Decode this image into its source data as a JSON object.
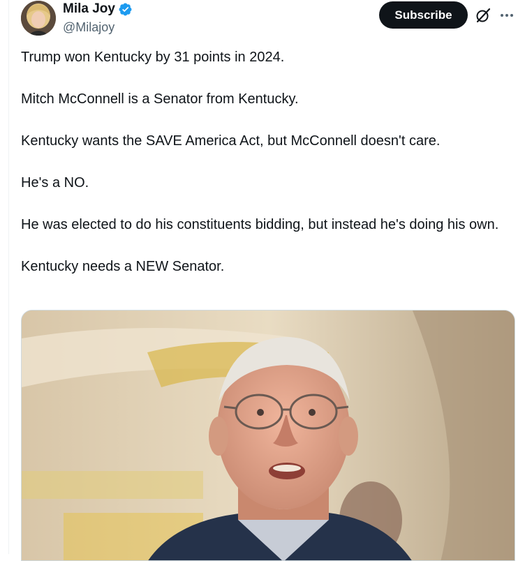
{
  "author": {
    "display_name": "Mila Joy",
    "handle": "@Milajoy",
    "verified": true,
    "verified_color": "#1d9bf0"
  },
  "actions": {
    "subscribe_label": "Subscribe"
  },
  "tweet": {
    "paragraphs": [
      "Trump won Kentucky by 31 points in 2024.",
      "Mitch McConnell is a Senator from Kentucky.",
      "Kentucky wants the SAVE America Act, but McConnell doesn't care.",
      "He's a NO.",
      "He was elected to do his constituents bidding, but instead he's doing his own.",
      "Kentucky needs a NEW Senator."
    ]
  },
  "icons": {
    "verified": "verified-badge-icon",
    "grok": "grok-icon",
    "more": "more-icon"
  }
}
